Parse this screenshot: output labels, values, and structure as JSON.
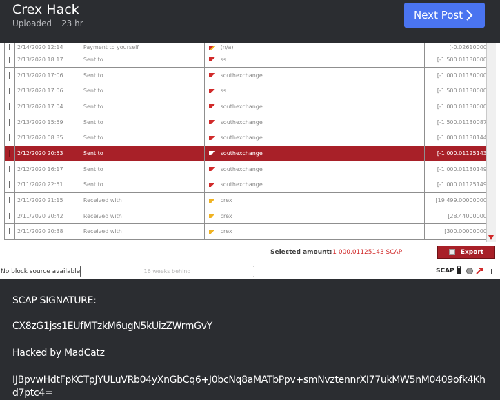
{
  "post": {
    "title": "Crex Hack",
    "status": "Uploaded",
    "age": "23 hr",
    "next_label": "Next Post"
  },
  "colors": {
    "header_bg": "#2b2d31",
    "accent_blue": "#4a74f0",
    "selected_row": "#a82028",
    "amount_red": "#d12a2a"
  },
  "transactions": [
    {
      "date": "2/14/2020 12:14",
      "type": "Payment to yourself",
      "address": "(n/a)",
      "amount": "[-0.02610000]",
      "icon": "self-payment-icon",
      "selected": false
    },
    {
      "date": "2/13/2020 18:17",
      "type": "Sent to",
      "address": "ss",
      "amount": "[-1 500.01130000]",
      "icon": "sent-icon",
      "selected": false
    },
    {
      "date": "2/13/2020 17:06",
      "type": "Sent to",
      "address": "southexchange",
      "amount": "[-1 000.01130000]",
      "icon": "sent-icon",
      "selected": false
    },
    {
      "date": "2/13/2020 17:06",
      "type": "Sent to",
      "address": "ss",
      "amount": "[-1 500.01130000]",
      "icon": "sent-icon",
      "selected": false
    },
    {
      "date": "2/13/2020 17:04",
      "type": "Sent to",
      "address": "southexchange",
      "amount": "[-1 000.01130000]",
      "icon": "sent-icon",
      "selected": false
    },
    {
      "date": "2/13/2020 15:59",
      "type": "Sent to",
      "address": "southexchange",
      "amount": "[-1 500.01130087]",
      "icon": "sent-icon",
      "selected": false
    },
    {
      "date": "2/13/2020 08:35",
      "type": "Sent to",
      "address": "southexchange",
      "amount": "[-1 000.01130144]",
      "icon": "sent-icon",
      "selected": false
    },
    {
      "date": "2/12/2020 20:53",
      "type": "Sent to",
      "address": "southexchange",
      "amount": "[-1 000.01125143]",
      "icon": "sent-icon",
      "selected": true
    },
    {
      "date": "2/12/2020 16:17",
      "type": "Sent to",
      "address": "southexchange",
      "amount": "[-1 000.01130149]",
      "icon": "sent-icon",
      "selected": false
    },
    {
      "date": "2/11/2020 22:51",
      "type": "Sent to",
      "address": "southexchange",
      "amount": "[-1 000.01125149]",
      "icon": "sent-icon",
      "selected": false
    },
    {
      "date": "2/11/2020 21:15",
      "type": "Received with",
      "address": "crex",
      "amount": "[19 499.00000000]",
      "icon": "received-icon",
      "selected": false
    },
    {
      "date": "2/11/2020 20:42",
      "type": "Received with",
      "address": "crex",
      "amount": "[28.44000000]",
      "icon": "received-icon",
      "selected": false
    },
    {
      "date": "2/11/2020 20:38",
      "type": "Received with",
      "address": "crex",
      "amount": "[300.00000000]",
      "icon": "received-icon",
      "selected": false
    }
  ],
  "selection": {
    "label": "Selected amount:",
    "value": "-1 000.01125143 SCAP"
  },
  "export_label": "Export",
  "status": {
    "block_source": "No block source available...",
    "sync_progress": "16 weeks behind",
    "unit": "SCAP"
  },
  "text": {
    "signature_heading": "SCAP SIGNATURE:",
    "signature_address": "CX8zG1jss1EUfMTzkM6ugN5kUizZWrmGvY",
    "message": "Hacked by MadCatz",
    "signature": "IJBpvwHdtFpKCTpJYULuVRb04yXnGbCq6+J0bcNq8aMATbPpv+smNvztennrXI77ukMW5nM0409ofk4Khd7ptc4="
  }
}
